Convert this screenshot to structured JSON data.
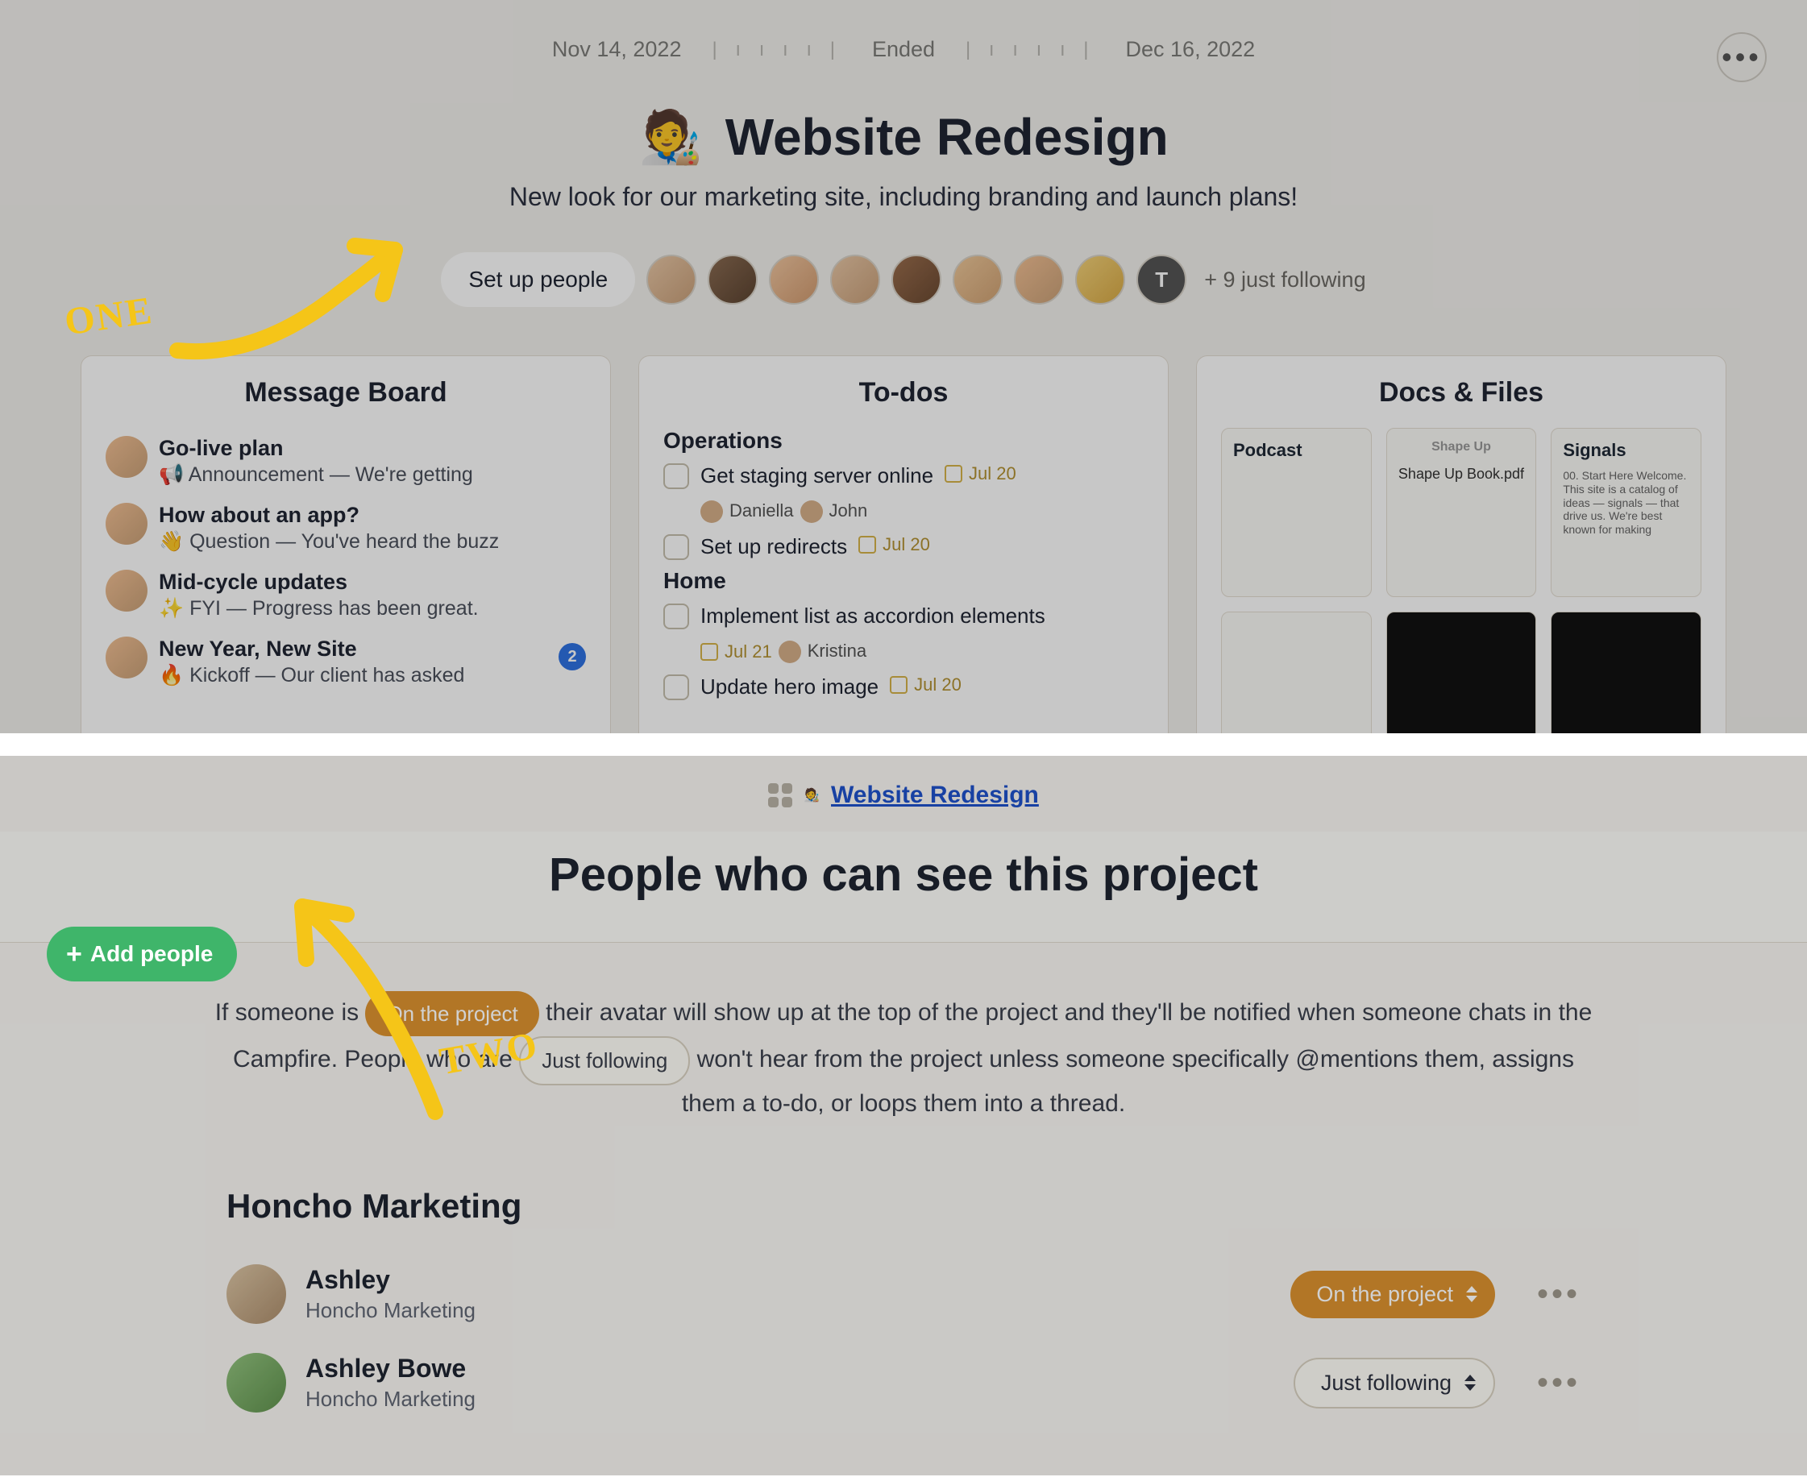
{
  "annotations": {
    "one": "ONE",
    "two": "TWO"
  },
  "header": {
    "start_date": "Nov 14, 2022",
    "status": "Ended",
    "end_date": "Dec 16, 2022",
    "project_emoji": "🧑‍🎨",
    "project_title": "Website Redesign",
    "project_subtitle": "New look for our marketing site, including branding and launch plans!",
    "setup_people_label": "Set up people",
    "extra_avatar_initial": "T",
    "follow_count_label": "+ 9 just following"
  },
  "cards": {
    "message_board": {
      "title": "Message Board",
      "items": [
        {
          "title": "Go-live plan",
          "sub": "📢 Announcement — We're getting"
        },
        {
          "title": "How about an app?",
          "sub": "👋 Question — You've heard the buzz"
        },
        {
          "title": "Mid-cycle updates",
          "sub": "✨ FYI — Progress has been great."
        },
        {
          "title": "New Year, New Site",
          "sub": "🔥 Kickoff — Our client has asked",
          "badge": "2"
        }
      ]
    },
    "todos": {
      "title": "To-dos",
      "groups": [
        {
          "name": "Operations",
          "items": [
            {
              "label": "Get staging server online",
              "date": "Jul 20",
              "assignees": [
                "Daniella",
                "John"
              ]
            },
            {
              "label": "Set up redirects",
              "date": "Jul 20"
            }
          ]
        },
        {
          "name": "Home",
          "items": [
            {
              "label": "Implement list as accordion elements",
              "date": "Jul 21",
              "assignees": [
                "Kristina"
              ]
            },
            {
              "label": "Update hero image",
              "date": "Jul 20"
            }
          ]
        }
      ]
    },
    "docs": {
      "title": "Docs & Files",
      "tiles": [
        {
          "title": "Podcast",
          "caption": ""
        },
        {
          "title": "Shape Up",
          "caption": "Shape Up Book.pdf"
        },
        {
          "title": "Signals",
          "body": "00. Start Here\nWelcome. This site is a catalog of ideas — signals — that drive us. We're best known for making"
        }
      ]
    }
  },
  "people_page": {
    "breadcrumb_label": "Website Redesign",
    "breadcrumb_emoji": "🧑‍🎨",
    "add_people_label": "Add people",
    "title": "People who can see this project",
    "explain_pre": "If someone is",
    "chip_on": "On the project",
    "explain_mid1": "their avatar will show up at the top of the project and they'll be notified when someone chats in the Campfire. People who are",
    "chip_follow": "Just following",
    "explain_mid2": "won't hear from the project unless someone specifically @mentions them, assigns them a to-do, or loops them into a thread.",
    "company": "Honcho Marketing",
    "people": [
      {
        "name": "Ashley",
        "company": "Honcho Marketing",
        "role": "On the project"
      },
      {
        "name": "Ashley Bowe",
        "company": "Honcho Marketing",
        "role": "Just following"
      }
    ]
  }
}
